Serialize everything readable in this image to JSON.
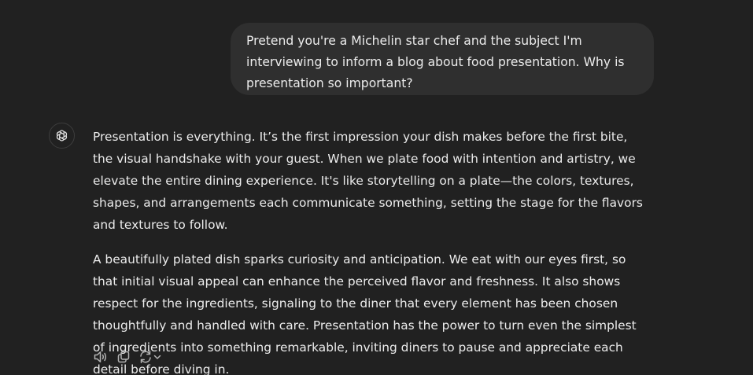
{
  "user_message": {
    "text": "Pretend you're a Michelin star chef and the subject I'm interviewing to inform a blog about food presentation. Why is presentation so important?"
  },
  "assistant": {
    "avatar_icon": "openai-logo-icon",
    "paragraphs": [
      "Presentation is everything. It’s the first impression your dish makes before the first bite, the visual handshake with your guest. When we plate food with intention and artistry, we elevate the entire dining experience. It's like storytelling on a plate—the colors, textures, shapes, and arrangements each communicate something, setting the stage for the flavors and textures to follow.",
      "A beautifully plated dish sparks curiosity and anticipation. We eat with our eyes first, so that initial visual appeal can enhance the perceived flavor and freshness. It also shows respect for the ingredients, signaling to the diner that every element has been chosen thoughtfully and handled with care. Presentation has the power to turn even the simplest of ingredients into something remarkable, inviting diners to pause and appreciate each detail before diving in."
    ]
  },
  "actions": {
    "read_aloud_icon": "speaker-icon",
    "copy_icon": "copy-icon",
    "regenerate_icon": "regenerate-icon",
    "regenerate_menu_icon": "chevron-down-icon"
  },
  "colors": {
    "background": "#212121",
    "user_bubble": "#2f2f2f",
    "text": "#ececec",
    "icon": "#b4b4b4"
  }
}
